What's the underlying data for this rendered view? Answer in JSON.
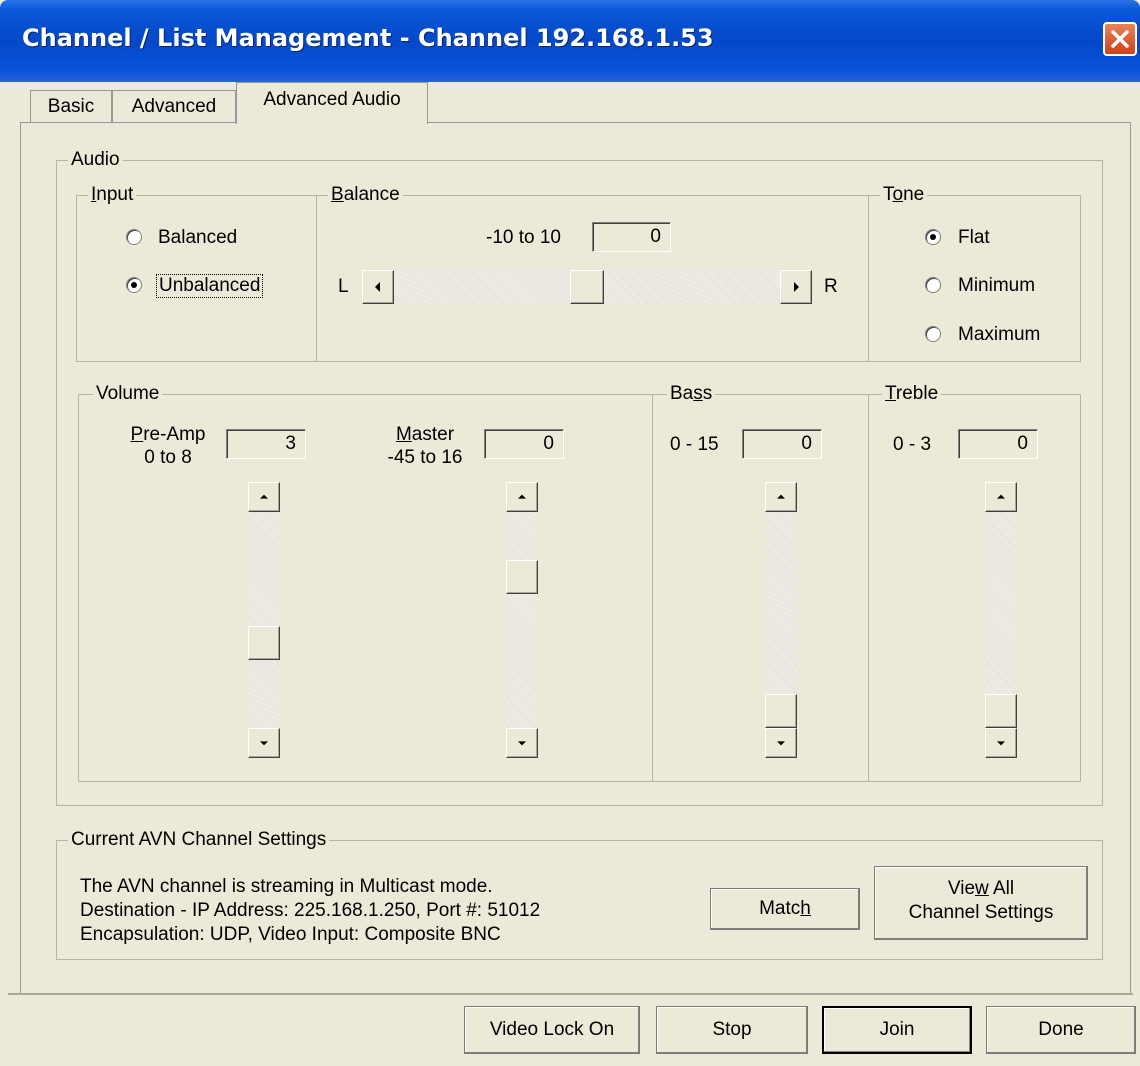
{
  "window": {
    "title": "Channel / List Management - Channel 192.168.1.53"
  },
  "tabs": [
    {
      "label": "Basic"
    },
    {
      "label": "Advanced"
    },
    {
      "label": "Advanced Audio"
    }
  ],
  "audio": {
    "legend": "Audio",
    "input": {
      "legend_u": "I",
      "legend_rest": "nput",
      "options": [
        {
          "label": "Balanced",
          "selected": false
        },
        {
          "label": "Unbalanced",
          "selected": true
        }
      ]
    },
    "balance": {
      "legend_u": "B",
      "legend_rest": "alance",
      "range_label": "-10 to 10",
      "value": "0",
      "left_label": "L",
      "right_label": "R",
      "slider_fraction": 0.5
    },
    "tone": {
      "legend_a": "T",
      "legend_u": "o",
      "legend_rest": "ne",
      "options": [
        {
          "label": "Flat",
          "selected": true
        },
        {
          "label": "Minimum",
          "selected": false
        },
        {
          "label": "Maximum",
          "selected": false
        }
      ]
    },
    "volume": {
      "legend": "Volume",
      "preamp": {
        "label_u": "P",
        "label_rest": "re-Amp",
        "range": "0 to 8",
        "value": "3",
        "slider_fraction": 0.625
      },
      "master": {
        "label_u": "M",
        "label_rest": "aster",
        "range": "-45 to 16",
        "value": "0",
        "slider_fraction": 0.262
      }
    },
    "bass": {
      "legend_a": "Ba",
      "legend_u": "s",
      "legend_rest": "s",
      "range": "0 - 15",
      "value": "0",
      "slider_fraction": 1.0
    },
    "treble": {
      "legend_u": "T",
      "legend_rest": "reble",
      "range": "0 - 3",
      "value": "0",
      "slider_fraction": 1.0
    }
  },
  "current_settings": {
    "legend": "Current AVN Channel Settings",
    "lines": [
      "The AVN channel is streaming in Multicast mode.",
      "Destination - IP Address: 225.168.1.250,  Port #: 51012",
      "Encapsulation: UDP,  Video Input: Composite BNC"
    ],
    "match_a": "Matc",
    "match_u": "h",
    "view_line1_a": "Vie",
    "view_line1_u": "w",
    "view_line1_rest": " All",
    "view_line2": "Channel Settings"
  },
  "footer": {
    "video_lock": "Video Lock On",
    "stop": "Stop",
    "join": "Join",
    "done": "Done"
  }
}
